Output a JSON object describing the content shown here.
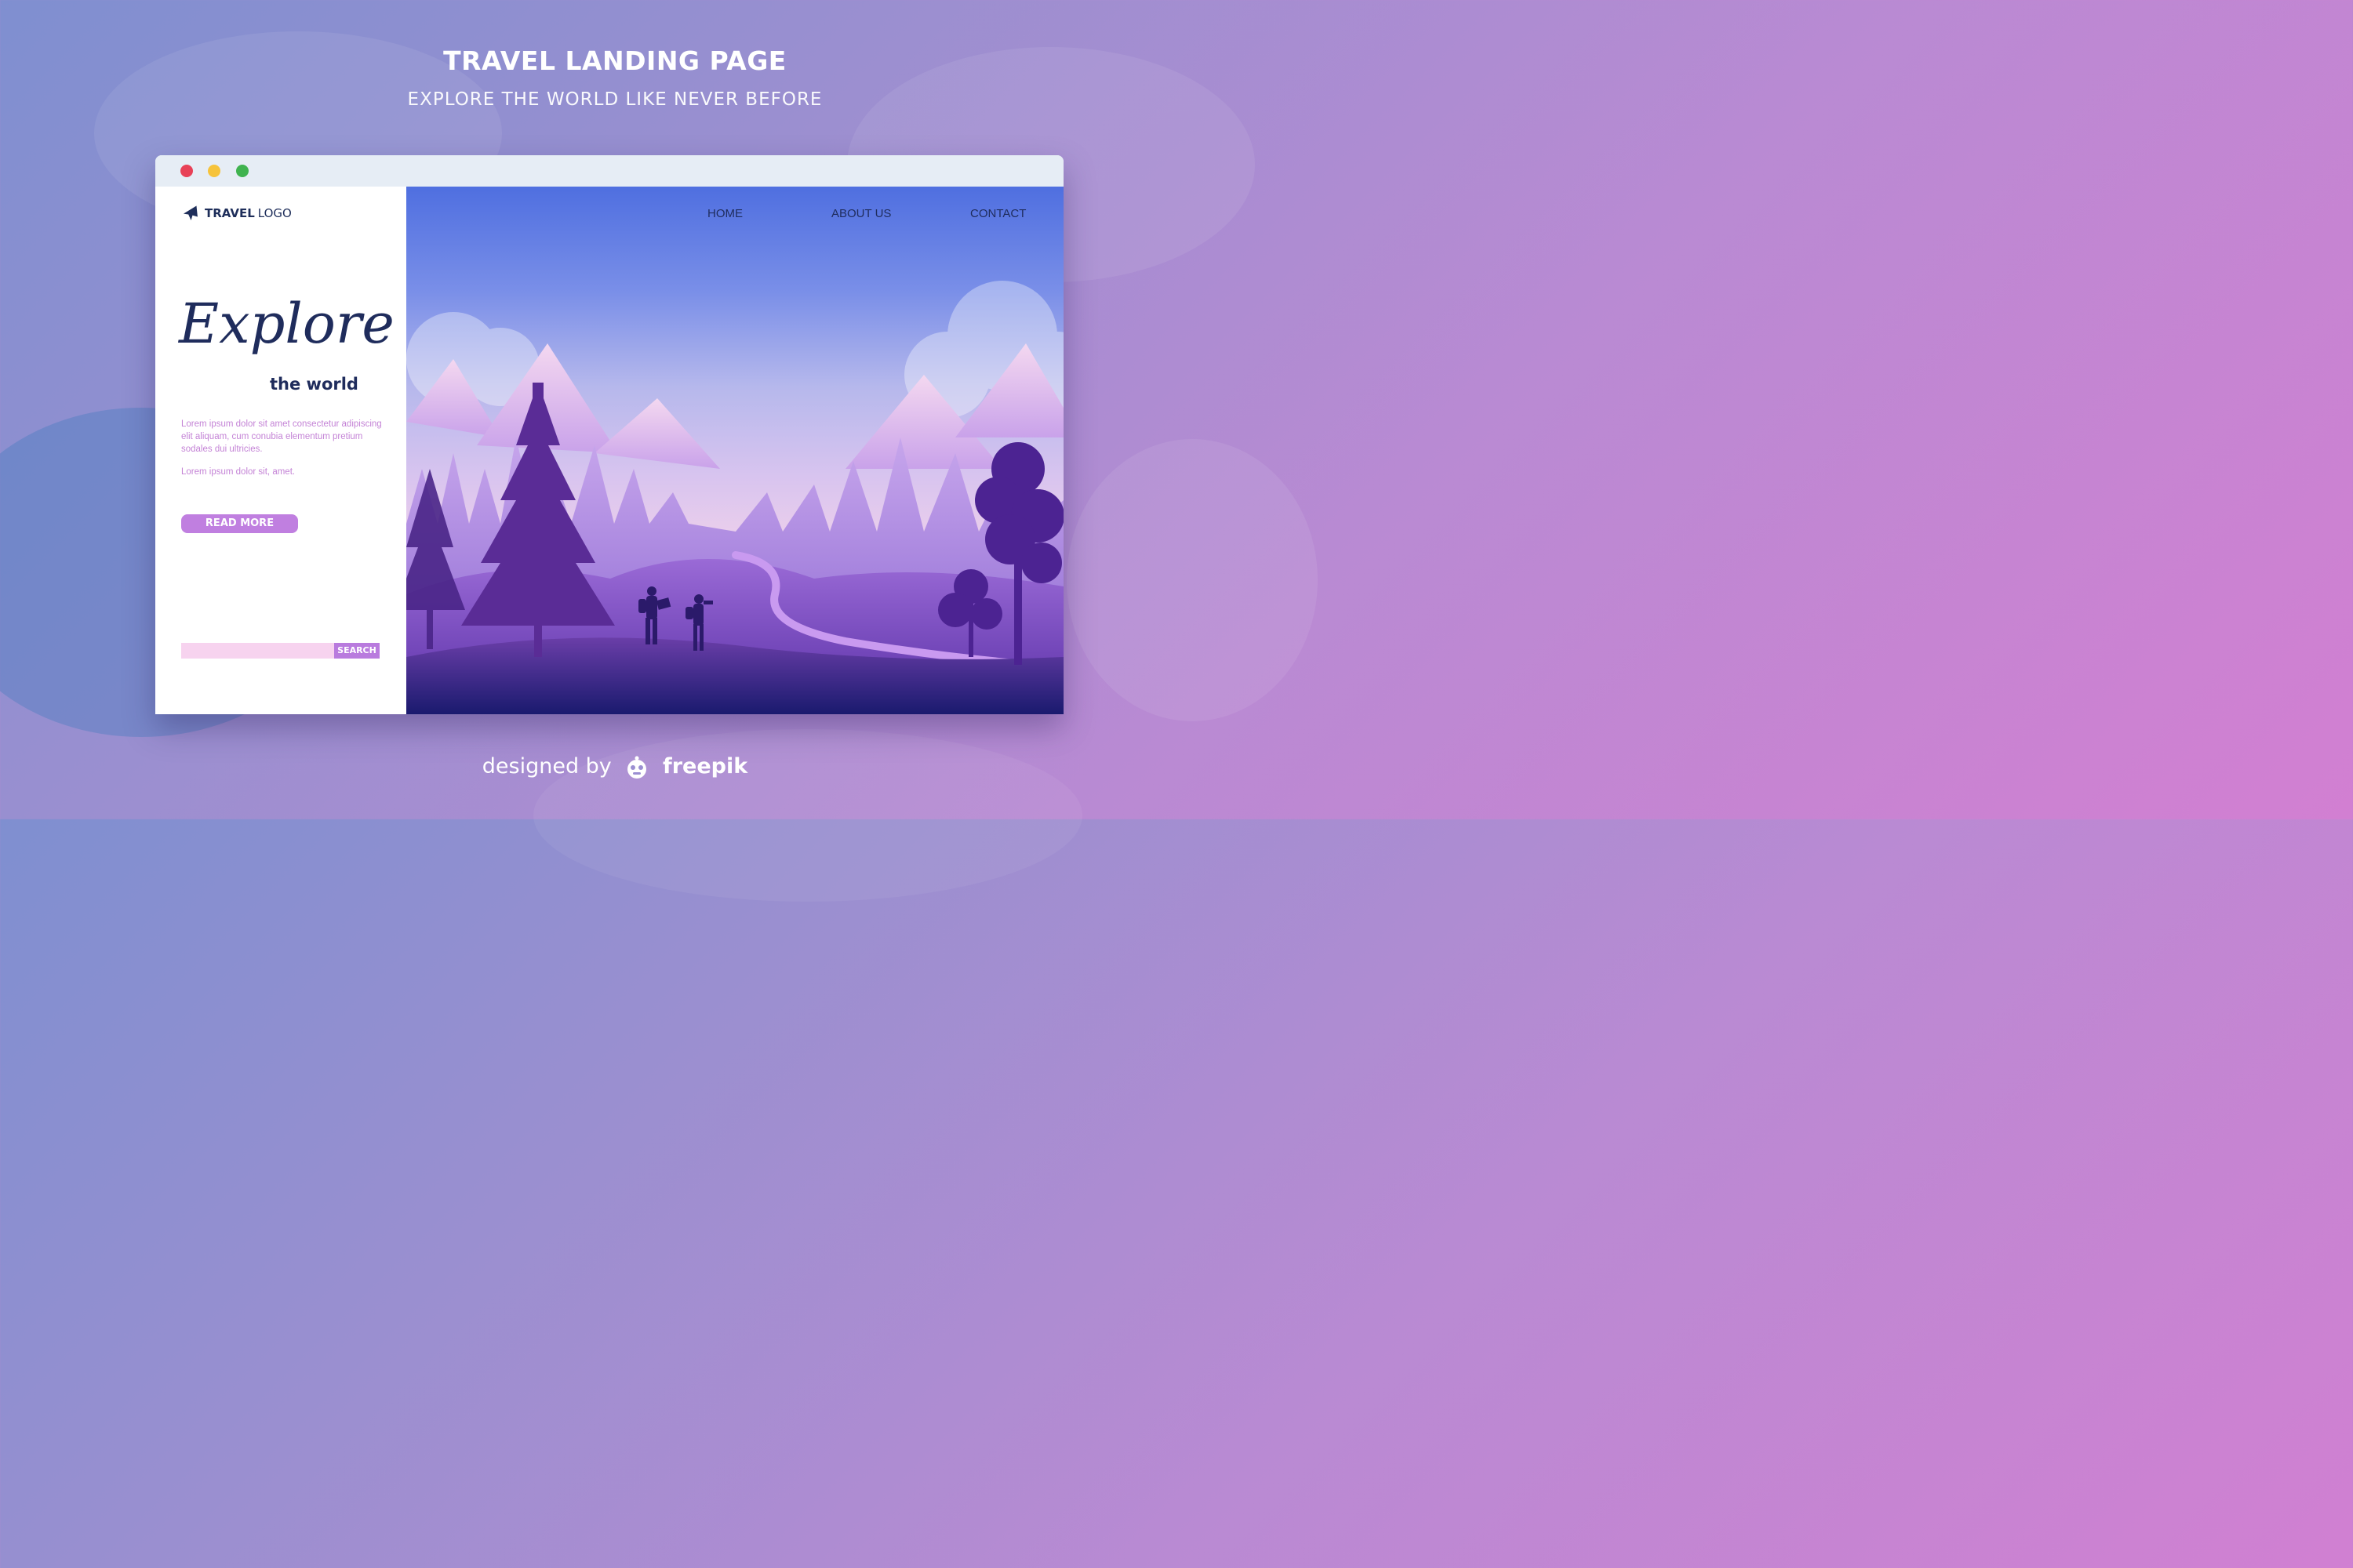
{
  "header": {
    "title": "TRAVEL LANDING PAGE",
    "subtitle": "EXPLORE THE WORLD LIKE NEVER BEFORE"
  },
  "browser": {
    "window_controls": [
      "close",
      "minimize",
      "maximize"
    ]
  },
  "logo": {
    "icon": "plane-icon",
    "bold": "TRAVEL",
    "light": "LOGO"
  },
  "nav": {
    "home": "HOME",
    "about": "ABOUT US",
    "contact": "CONTACT"
  },
  "hero": {
    "headline": "Explore",
    "subheadline": "the world",
    "paragraph": "Lorem ipsum dolor sit amet consectetur adipiscing elit aliquam, cum conubia elementum pretium sodales dui ultricies.",
    "paragraph2": "Lorem ipsum dolor sit, amet.",
    "read_more": "READ MORE"
  },
  "search": {
    "value": "",
    "placeholder": "",
    "button": "SEARCH"
  },
  "footer": {
    "credit_prefix": "designed by",
    "brand": "freepik"
  },
  "colors": {
    "accent": "#c07fe0",
    "dark_text": "#1f2c5c",
    "lorem_text": "#c483d6",
    "search_bg": "#f7d3ef"
  }
}
